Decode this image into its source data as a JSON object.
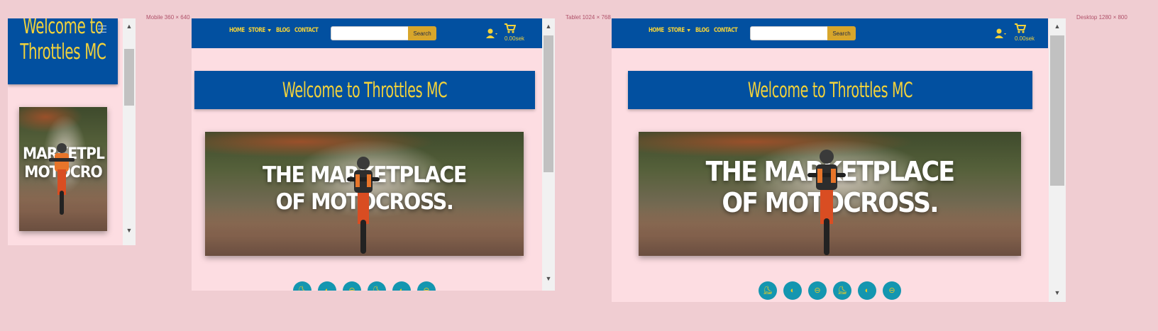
{
  "colors": {
    "navbar": "#0250a0",
    "accent": "#f3d23a",
    "page_bg": "#f0cdd2",
    "frame_bg": "#fddde2",
    "search_btn": "#d8a62b",
    "circle": "#1496b0"
  },
  "labels": {
    "mobile": "Mobile 360 × 640",
    "tablet": "Tablet 1024 × 768",
    "desktop": "Desktop 1280 × 800"
  },
  "nav": {
    "home": "HOME",
    "store": "STORE",
    "blog": "BLOG",
    "contact": "CONTACT",
    "search_placeholder": "",
    "search_button": "Search",
    "cart_total": "0.00sek",
    "user_icon": "user-icon",
    "cart_icon": "shopping-cart-icon",
    "menu_icon": "hamburger-menu-icon"
  },
  "welcome": {
    "full": "Welcome to Throttles MC",
    "mobile_line1": "Welcome to",
    "mobile_line2": "Throttles MC"
  },
  "hero": {
    "line1": "THE MARKETPLACE",
    "line2": "OF MOTOCROSS.",
    "mobile_line1": "MARKETPL",
    "mobile_line2": "MOTOCRO"
  },
  "categories": [
    {
      "icon": "boot-icon",
      "glyph": "⛸"
    },
    {
      "icon": "helmet-icon",
      "glyph": "◐"
    },
    {
      "icon": "goggles-icon",
      "glyph": "⊖"
    },
    {
      "icon": "boot-icon",
      "glyph": "⛸"
    },
    {
      "icon": "helmet-icon",
      "glyph": "◐"
    },
    {
      "icon": "goggles-icon",
      "glyph": "⊖"
    }
  ]
}
